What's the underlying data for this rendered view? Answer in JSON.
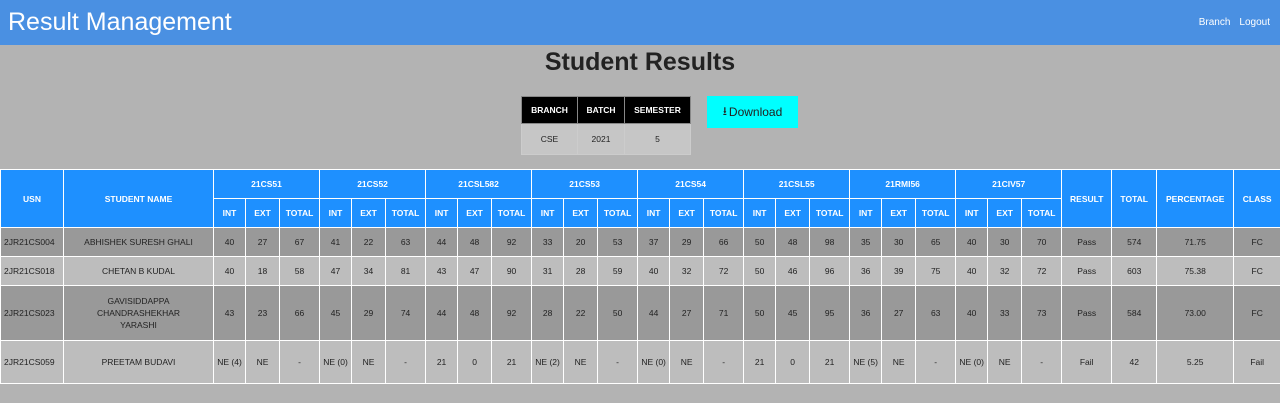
{
  "header": {
    "title": "Result Management",
    "nav": [
      "Branch",
      "Logout"
    ]
  },
  "page_title": "Student Results",
  "info": {
    "headers": [
      "BRANCH",
      "BATCH",
      "SEMESTER"
    ],
    "values": [
      "CSE",
      "2021",
      "5"
    ]
  },
  "download": {
    "icon": "download-arrow-icon",
    "glyph": "⭳",
    "label": "Download"
  },
  "results": {
    "columns": {
      "usn": "USN",
      "name": "STUDENT NAME",
      "subjects": [
        "21CS51",
        "21CS52",
        "21CSL582",
        "21CS53",
        "21CS54",
        "21CSL55",
        "21RMI56",
        "21CIV57"
      ],
      "sub_headers": [
        "INT",
        "EXT",
        "TOTAL"
      ],
      "result": "RESULT",
      "total": "TOTAL",
      "percentage": "PERCENTAGE",
      "class": "CLASS"
    },
    "rows": [
      {
        "usn": "2JR21CS004",
        "name": "ABHISHEK SURESH GHALI",
        "marks": [
          [
            "40",
            "27",
            "67"
          ],
          [
            "41",
            "22",
            "63"
          ],
          [
            "44",
            "48",
            "92"
          ],
          [
            "33",
            "20",
            "53"
          ],
          [
            "37",
            "29",
            "66"
          ],
          [
            "50",
            "48",
            "98"
          ],
          [
            "35",
            "30",
            "65"
          ],
          [
            "40",
            "30",
            "70"
          ]
        ],
        "result": "Pass",
        "total": "574",
        "percentage": "71.75",
        "class": "FC"
      },
      {
        "usn": "2JR21CS018",
        "name": "CHETAN B KUDAL",
        "marks": [
          [
            "40",
            "18",
            "58"
          ],
          [
            "47",
            "34",
            "81"
          ],
          [
            "43",
            "47",
            "90"
          ],
          [
            "31",
            "28",
            "59"
          ],
          [
            "40",
            "32",
            "72"
          ],
          [
            "50",
            "46",
            "96"
          ],
          [
            "36",
            "39",
            "75"
          ],
          [
            "40",
            "32",
            "72"
          ]
        ],
        "result": "Pass",
        "total": "603",
        "percentage": "75.38",
        "class": "FC"
      },
      {
        "usn": "2JR21CS023",
        "name": "GAVISIDDAPPA CHANDRASHEKHAR YARASHI",
        "marks": [
          [
            "43",
            "23",
            "66"
          ],
          [
            "45",
            "29",
            "74"
          ],
          [
            "44",
            "48",
            "92"
          ],
          [
            "28",
            "22",
            "50"
          ],
          [
            "44",
            "27",
            "71"
          ],
          [
            "50",
            "45",
            "95"
          ],
          [
            "36",
            "27",
            "63"
          ],
          [
            "40",
            "33",
            "73"
          ]
        ],
        "result": "Pass",
        "total": "584",
        "percentage": "73.00",
        "class": "FC"
      },
      {
        "usn": "2JR21CS059",
        "name": "PREETAM BUDAVI",
        "marks": [
          [
            "NE (4)",
            "NE",
            "-"
          ],
          [
            "NE (0)",
            "NE",
            "-"
          ],
          [
            "21",
            "0",
            "21"
          ],
          [
            "NE (2)",
            "NE",
            "-"
          ],
          [
            "NE (0)",
            "NE",
            "-"
          ],
          [
            "21",
            "0",
            "21"
          ],
          [
            "NE (5)",
            "NE",
            "-"
          ],
          [
            "NE (0)",
            "NE",
            "-"
          ]
        ],
        "result": "Fail",
        "total": "42",
        "percentage": "5.25",
        "class": "Fail"
      }
    ]
  }
}
